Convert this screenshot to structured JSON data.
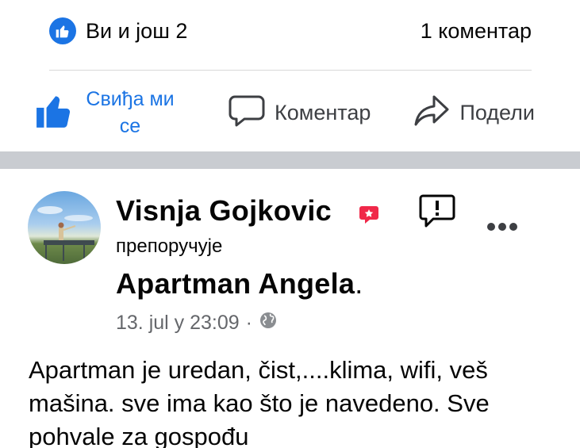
{
  "reactions": {
    "summary": "Ви и још 2",
    "comments": "1 коментар"
  },
  "actions": {
    "like": "Свиђа ми се",
    "comment": "Коментар",
    "share": "Подели"
  },
  "review": {
    "author": "Visnja Gojkovic",
    "recommends": "препоручује",
    "page": "Apartman Angela",
    "page_suffix": ".",
    "timestamp": "13. jul у 23:09",
    "separator": "·",
    "privacy_icon": "globe-icon",
    "text": "Apartman je uredan,  čist,....klima,  wifi, veš  mašina. sve ima kao što je navedeno.  Sve pohvale za gospođu"
  },
  "colors": {
    "accent": "#1b74e4",
    "separator": "#c9ccd1",
    "muted": "#65676b",
    "badge": "#f02849"
  }
}
